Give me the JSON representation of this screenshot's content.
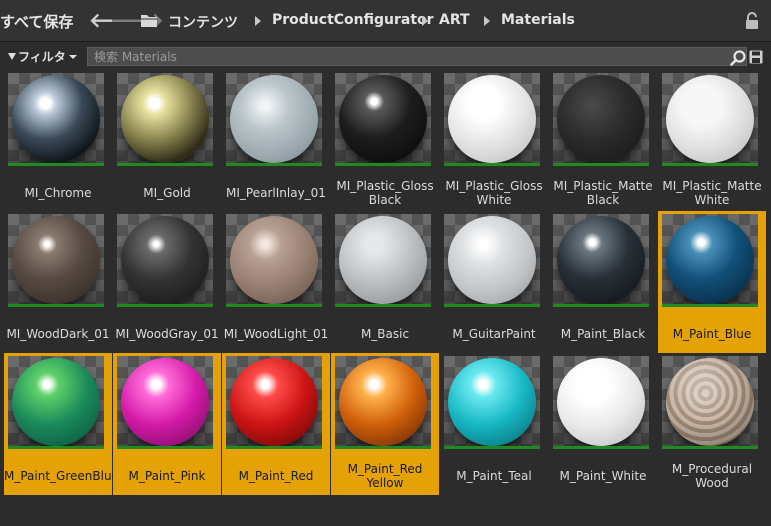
{
  "toolbar": {
    "save_all_label": "すべて保存",
    "nav_back": "🡐",
    "nav_forward": "🡒",
    "breadcrumb": [
      "コンテンツ",
      "ProductConfigurator",
      "ART",
      "Materials"
    ]
  },
  "filter": {
    "filter_label": "フィルタ",
    "search_placeholder": "検索 Materials",
    "search_value": ""
  },
  "colors": {
    "selection": "#e5a207",
    "asset_underline": "#1f8a1f"
  },
  "assets": [
    {
      "line1": "MI_Chrome",
      "line2": "",
      "selected": false,
      "material": "chrome"
    },
    {
      "line1": "MI_Gold",
      "line2": "",
      "selected": false,
      "material": "gold"
    },
    {
      "line1": "MI_PearlInlay_01",
      "line2": "",
      "selected": false,
      "material": "pearl"
    },
    {
      "line1": "MI_Plastic_Gloss",
      "line2": "Black",
      "selected": false,
      "material": "plastic-gloss-black"
    },
    {
      "line1": "MI_Plastic_Gloss",
      "line2": "White",
      "selected": false,
      "material": "plastic-gloss-white"
    },
    {
      "line1": "MI_Plastic_Matte",
      "line2": "Black",
      "selected": false,
      "material": "plastic-matte-black"
    },
    {
      "line1": "MI_Plastic_Matte",
      "line2": "White",
      "selected": false,
      "material": "plastic-matte-white"
    },
    {
      "line1": "MI_WoodDark_01",
      "line2": "",
      "selected": false,
      "material": "wood-dark"
    },
    {
      "line1": "MI_WoodGray_01",
      "line2": "",
      "selected": false,
      "material": "wood-gray"
    },
    {
      "line1": "MI_WoodLight_01",
      "line2": "",
      "selected": false,
      "material": "wood-light"
    },
    {
      "line1": "M_Basic",
      "line2": "",
      "selected": false,
      "material": "basic"
    },
    {
      "line1": "M_GuitarPaint",
      "line2": "",
      "selected": false,
      "material": "guitar-paint"
    },
    {
      "line1": "M_Paint_Black",
      "line2": "",
      "selected": false,
      "material": "paint-black"
    },
    {
      "line1": "M_Paint_Blue",
      "line2": "",
      "selected": true,
      "material": "paint-blue"
    },
    {
      "line1": "M_Paint_GreenBlue",
      "line2": "",
      "selected": true,
      "material": "paint-greenblue"
    },
    {
      "line1": "M_Paint_Pink",
      "line2": "",
      "selected": true,
      "material": "paint-pink"
    },
    {
      "line1": "M_Paint_Red",
      "line2": "",
      "selected": true,
      "material": "paint-red"
    },
    {
      "line1": "M_Paint_Red",
      "line2": "Yellow",
      "selected": true,
      "material": "paint-red-yellow"
    },
    {
      "line1": "M_Paint_Teal",
      "line2": "",
      "selected": false,
      "material": "paint-teal"
    },
    {
      "line1": "M_Paint_White",
      "line2": "",
      "selected": false,
      "material": "paint-white"
    },
    {
      "line1": "M_Procedural",
      "line2": "Wood",
      "selected": false,
      "material": "procedural-wood"
    }
  ]
}
